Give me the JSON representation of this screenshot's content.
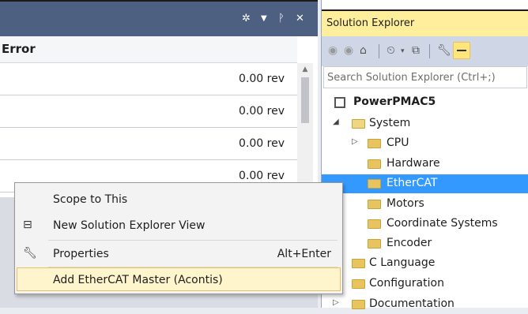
{
  "left_panel": {
    "header": "Error",
    "rows": [
      "0.00 rev",
      "0.00 rev",
      "0.00 rev",
      "0.00 rev"
    ],
    "title_icons": [
      "gear-icon",
      "dropdown-icon",
      "pin-icon",
      "close-icon"
    ]
  },
  "solution_explorer": {
    "title": "Solution Explorer",
    "search_placeholder": "Search Solution Explorer (Ctrl+;)",
    "tree": {
      "root": "PowerPMAC5",
      "system": "System",
      "cpu": "CPU",
      "hardware": "Hardware",
      "ethercat": "EtherCAT",
      "motors": "Motors",
      "coordinate_systems": "Coordinate Systems",
      "encoder": "Encoder",
      "c_language": "C Language",
      "configuration": "Configuration",
      "documentation": "Documentation"
    }
  },
  "context_menu": {
    "scope": "Scope to This",
    "new_view": "New Solution Explorer View",
    "properties": "Properties",
    "properties_shortcut": "Alt+Enter",
    "add_master": "Add EtherCAT Master (Acontis)"
  },
  "colors": {
    "title_bar": "#4d6082",
    "solution_title": "#ffef9c",
    "selection": "#3399ff",
    "menu_highlight": "#fff5cc"
  }
}
